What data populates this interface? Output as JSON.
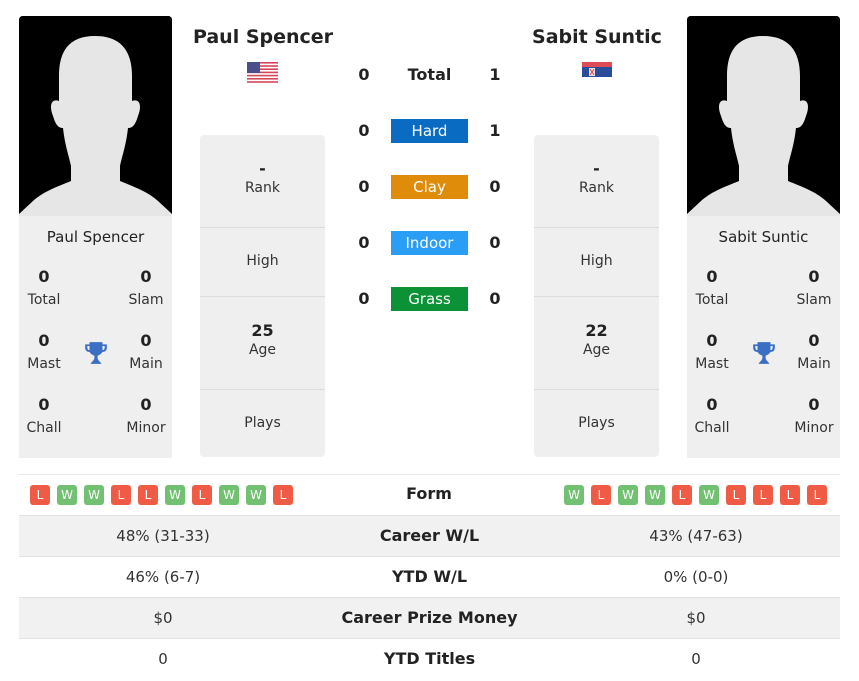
{
  "players": {
    "left": {
      "name": "Paul Spencer",
      "country_flag": "usa-flag-icon",
      "titles": {
        "total": {
          "value": "0",
          "label": "Total"
        },
        "slam": {
          "value": "0",
          "label": "Slam"
        },
        "mast": {
          "value": "0",
          "label": "Mast"
        },
        "main": {
          "value": "0",
          "label": "Main"
        },
        "chall": {
          "value": "0",
          "label": "Chall"
        },
        "minor": {
          "value": "0",
          "label": "Minor"
        }
      },
      "info": {
        "rank": {
          "value": "-",
          "label": "Rank"
        },
        "high": {
          "value": "",
          "label": "High"
        },
        "age": {
          "value": "25",
          "label": "Age"
        },
        "plays": {
          "value": "",
          "label": "Plays"
        }
      },
      "form": [
        "L",
        "W",
        "W",
        "L",
        "L",
        "W",
        "L",
        "W",
        "W",
        "L"
      ]
    },
    "right": {
      "name": "Sabit Suntic",
      "country_flag": "serbia-flag-icon",
      "titles": {
        "total": {
          "value": "0",
          "label": "Total"
        },
        "slam": {
          "value": "0",
          "label": "Slam"
        },
        "mast": {
          "value": "0",
          "label": "Mast"
        },
        "main": {
          "value": "0",
          "label": "Main"
        },
        "chall": {
          "value": "0",
          "label": "Chall"
        },
        "minor": {
          "value": "0",
          "label": "Minor"
        }
      },
      "info": {
        "rank": {
          "value": "-",
          "label": "Rank"
        },
        "high": {
          "value": "",
          "label": "High"
        },
        "age": {
          "value": "22",
          "label": "Age"
        },
        "plays": {
          "value": "",
          "label": "Plays"
        }
      },
      "form": [
        "W",
        "L",
        "W",
        "W",
        "L",
        "W",
        "L",
        "L",
        "L",
        "L"
      ]
    }
  },
  "h2h": [
    {
      "label": "Total",
      "left": "0",
      "right": "1",
      "color": ""
    },
    {
      "label": "Hard",
      "left": "0",
      "right": "1",
      "color": "#0a6bc2"
    },
    {
      "label": "Clay",
      "left": "0",
      "right": "0",
      "color": "#de8c0a"
    },
    {
      "label": "Indoor",
      "left": "0",
      "right": "0",
      "color": "#2a9df4"
    },
    {
      "label": "Grass",
      "left": "0",
      "right": "0",
      "color": "#0c9236"
    }
  ],
  "form_label": "Form",
  "stats": [
    {
      "label": "Career W/L",
      "left": "48% (31-33)",
      "right": "43% (47-63)"
    },
    {
      "label": "YTD W/L",
      "left": "46% (6-7)",
      "right": "0% (0-0)"
    },
    {
      "label": "Career Prize Money",
      "left": "$0",
      "right": "$0"
    },
    {
      "label": "YTD Titles",
      "left": "0",
      "right": "0"
    }
  ]
}
